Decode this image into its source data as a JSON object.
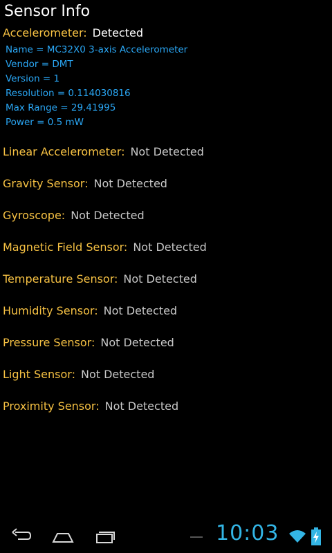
{
  "app": {
    "title": "Sensor Info"
  },
  "accelerometer": {
    "name": "Accelerometer:",
    "status": "Detected",
    "details": [
      "Name = MC32X0 3-axis Accelerometer",
      "Vendor = DMT",
      "Version = 1",
      "Resolution = 0.114030816",
      "Max Range = 29.41995",
      "Power = 0.5 mW"
    ]
  },
  "sensors": [
    {
      "name": "Linear Accelerometer:",
      "status": "Not Detected"
    },
    {
      "name": "Gravity Sensor:",
      "status": "Not Detected"
    },
    {
      "name": "Gyroscope:",
      "status": "Not Detected"
    },
    {
      "name": "Magnetic Field Sensor:",
      "status": "Not Detected"
    },
    {
      "name": "Temperature Sensor:",
      "status": "Not Detected"
    },
    {
      "name": "Humidity Sensor:",
      "status": "Not Detected"
    },
    {
      "name": "Pressure Sensor:",
      "status": "Not Detected"
    },
    {
      "name": "Light Sensor:",
      "status": "Not Detected"
    },
    {
      "name": "Proximity Sensor:",
      "status": "Not Detected"
    }
  ],
  "statusbar": {
    "time": "10:03",
    "icons": [
      "back-icon",
      "home-icon",
      "recent-apps-icon",
      "wifi-icon",
      "battery-charging-icon"
    ]
  },
  "colors": {
    "label": "#f6c143",
    "detail": "#2aa7f5",
    "clock": "#33b5e5"
  }
}
